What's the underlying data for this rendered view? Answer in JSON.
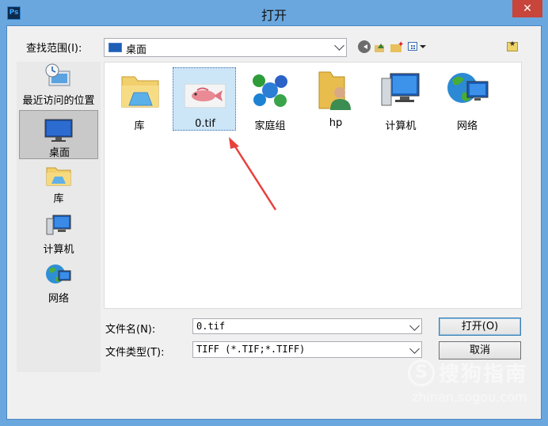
{
  "window": {
    "title": "打开",
    "app_icon_text": "Ps",
    "close_glyph": "✕"
  },
  "toolbar": {
    "lookin_label": "查找范围(I):",
    "lookin_value": "桌面",
    "back_icon": "back-icon",
    "up_icon": "up-folder-icon",
    "new_folder_icon": "new-folder-icon",
    "view_icon": "view-menu-icon"
  },
  "places": [
    {
      "label": "最近访问的位置",
      "icon": "recent-places-icon"
    },
    {
      "label": "桌面",
      "icon": "desktop-icon",
      "selected": true
    },
    {
      "label": "库",
      "icon": "library-icon"
    },
    {
      "label": "计算机",
      "icon": "computer-icon"
    },
    {
      "label": "网络",
      "icon": "network-icon"
    }
  ],
  "files": [
    {
      "label": "库",
      "icon": "library-folder-icon"
    },
    {
      "label": "0.tif",
      "icon": "tif-image-thumbnail",
      "selected": true
    },
    {
      "label": "家庭组",
      "icon": "homegroup-icon"
    },
    {
      "label": "hp",
      "icon": "user-folder-icon"
    },
    {
      "label": "计算机",
      "icon": "computer-icon"
    },
    {
      "label": "网络",
      "icon": "network-icon"
    }
  ],
  "form": {
    "filename_label": "文件名(N):",
    "filename_value": "0.tif",
    "filetype_label": "文件类型(T):",
    "filetype_value": "TIFF (*.TIF;*.TIFF)"
  },
  "buttons": {
    "open": "打开(O)",
    "cancel": "取消"
  },
  "watermark": {
    "logo_letter": "S",
    "name": "搜狗指南",
    "url": "zhinan.sogou.com"
  },
  "colors": {
    "titlebar": "#6aa7df",
    "close_button": "#c7453a",
    "selection": "#cce5f7",
    "annotation_arrow": "#e8413c"
  }
}
